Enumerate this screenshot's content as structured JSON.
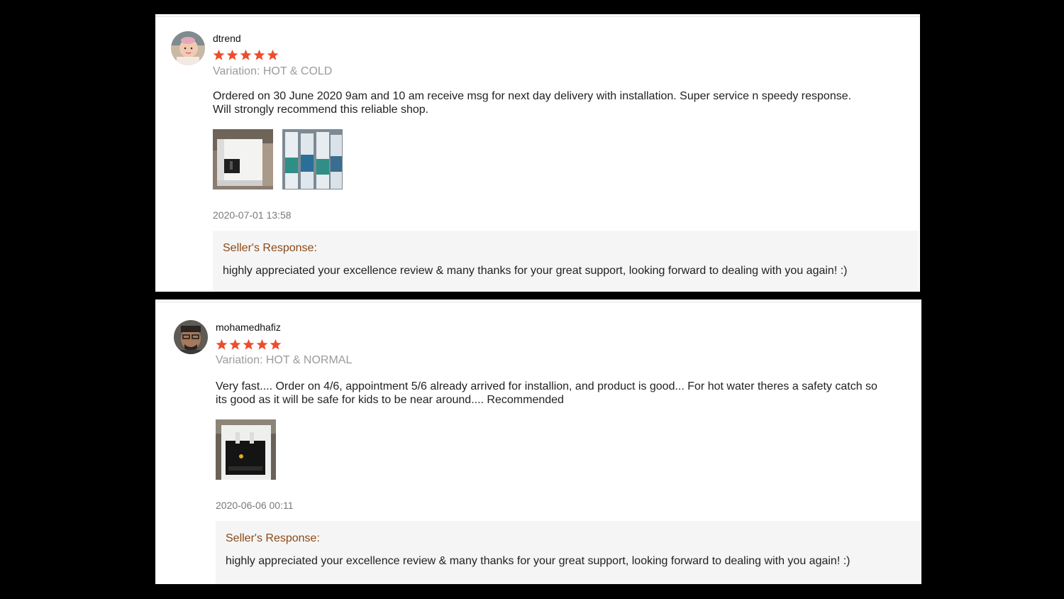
{
  "reviews": [
    {
      "username": "dtrend",
      "rating": 5,
      "variation": "Variation: HOT & COLD",
      "comment_line1": "Ordered on 30 June 2020 9am and 10 am receive msg for next day delivery with installation. Super service n speedy response.",
      "comment_line2": "Will strongly recommend this reliable shop.",
      "timestamp": "2020-07-01 13:58",
      "seller_label": "Seller's Response:",
      "seller_text": "highly appreciated your excellence review & many thanks for your great support, looking forward to dealing with you again! :)"
    },
    {
      "username": "mohamedhafiz",
      "rating": 5,
      "variation": "Variation: HOT & NORMAL",
      "comment_line1": "Very fast.... Order on 4/6, appointment 5/6 already arrived for installion,  and product is good...  For hot water theres a safety catch so",
      "comment_line2": "its good as it will be safe for kids to be near around....  Recommended",
      "timestamp": "2020-06-06 00:11",
      "seller_label": "Seller's Response:",
      "seller_text": "highly appreciated your excellence review & many thanks for your great support, looking forward to dealing with you again! :)"
    }
  ],
  "colors": {
    "star": "#ee4d2d",
    "seller_label": "#8b4a17",
    "muted": "#9b9b9b"
  }
}
